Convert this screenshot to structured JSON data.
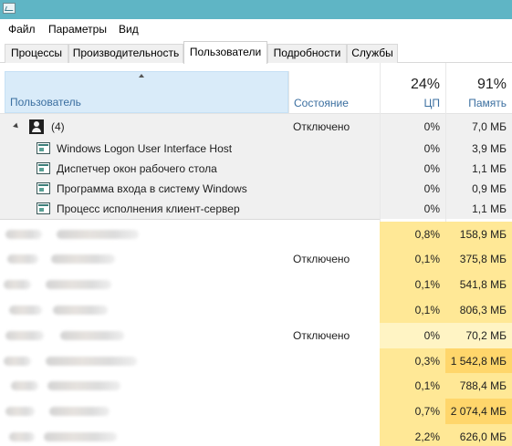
{
  "menu": {
    "items": [
      "Файл",
      "Параметры",
      "Вид"
    ]
  },
  "tabs": [
    "Процессы",
    "Производительность",
    "Пользователи",
    "Подробности",
    "Службы"
  ],
  "columns": {
    "user": "Пользователь",
    "state": "Состояние",
    "cpu_label": "ЦП",
    "cpu_total": "24%",
    "mem_label": "Память",
    "mem_total": "91%"
  },
  "group": {
    "label": "(4)",
    "state": "Отключено",
    "cpu": "0%",
    "mem": "7,0 МБ",
    "processes": [
      {
        "name": "Windows Logon User Interface Host",
        "cpu": "0%",
        "mem": "3,9 МБ"
      },
      {
        "name": "Диспетчер окон рабочего стола",
        "cpu": "0%",
        "mem": "1,1 МБ"
      },
      {
        "name": "Программа входа в систему Windows",
        "cpu": "0%",
        "mem": "0,9 МБ"
      },
      {
        "name": "Процесс исполнения клиент-сервер",
        "cpu": "0%",
        "mem": "1,1 МБ"
      }
    ]
  },
  "users": [
    {
      "state": "",
      "cpu": "0,8%",
      "mem": "158,9 МБ",
      "cpu_level": 0.8,
      "mem_level": 158.9
    },
    {
      "state": "Отключено",
      "cpu": "0,1%",
      "mem": "375,8 МБ",
      "cpu_level": 0.1,
      "mem_level": 375.8
    },
    {
      "state": "",
      "cpu": "0,1%",
      "mem": "541,8 МБ",
      "cpu_level": 0.1,
      "mem_level": 541.8
    },
    {
      "state": "",
      "cpu": "0,1%",
      "mem": "806,3 МБ",
      "cpu_level": 0.1,
      "mem_level": 806.3
    },
    {
      "state": "Отключено",
      "cpu": "0%",
      "mem": "70,2 МБ",
      "cpu_level": 0,
      "mem_level": 70.2
    },
    {
      "state": "",
      "cpu": "0,3%",
      "mem": "1 542,8 МБ",
      "cpu_level": 0.3,
      "mem_level": 1542.8
    },
    {
      "state": "",
      "cpu": "0,1%",
      "mem": "788,4 МБ",
      "cpu_level": 0.1,
      "mem_level": 788.4
    },
    {
      "state": "",
      "cpu": "0,7%",
      "mem": "2 074,4 МБ",
      "cpu_level": 0.7,
      "mem_level": 2074.4
    },
    {
      "state": "",
      "cpu": "2,2%",
      "mem": "626,0 МБ",
      "cpu_level": 2.2,
      "mem_level": 626.0
    }
  ],
  "colors": {
    "titlebar": "#5fb5c5",
    "header_selected": "#d9ebf9",
    "heat_low": "#fff4c4",
    "heat_mid": "#ffe896",
    "heat_high": "#ffd66b"
  }
}
